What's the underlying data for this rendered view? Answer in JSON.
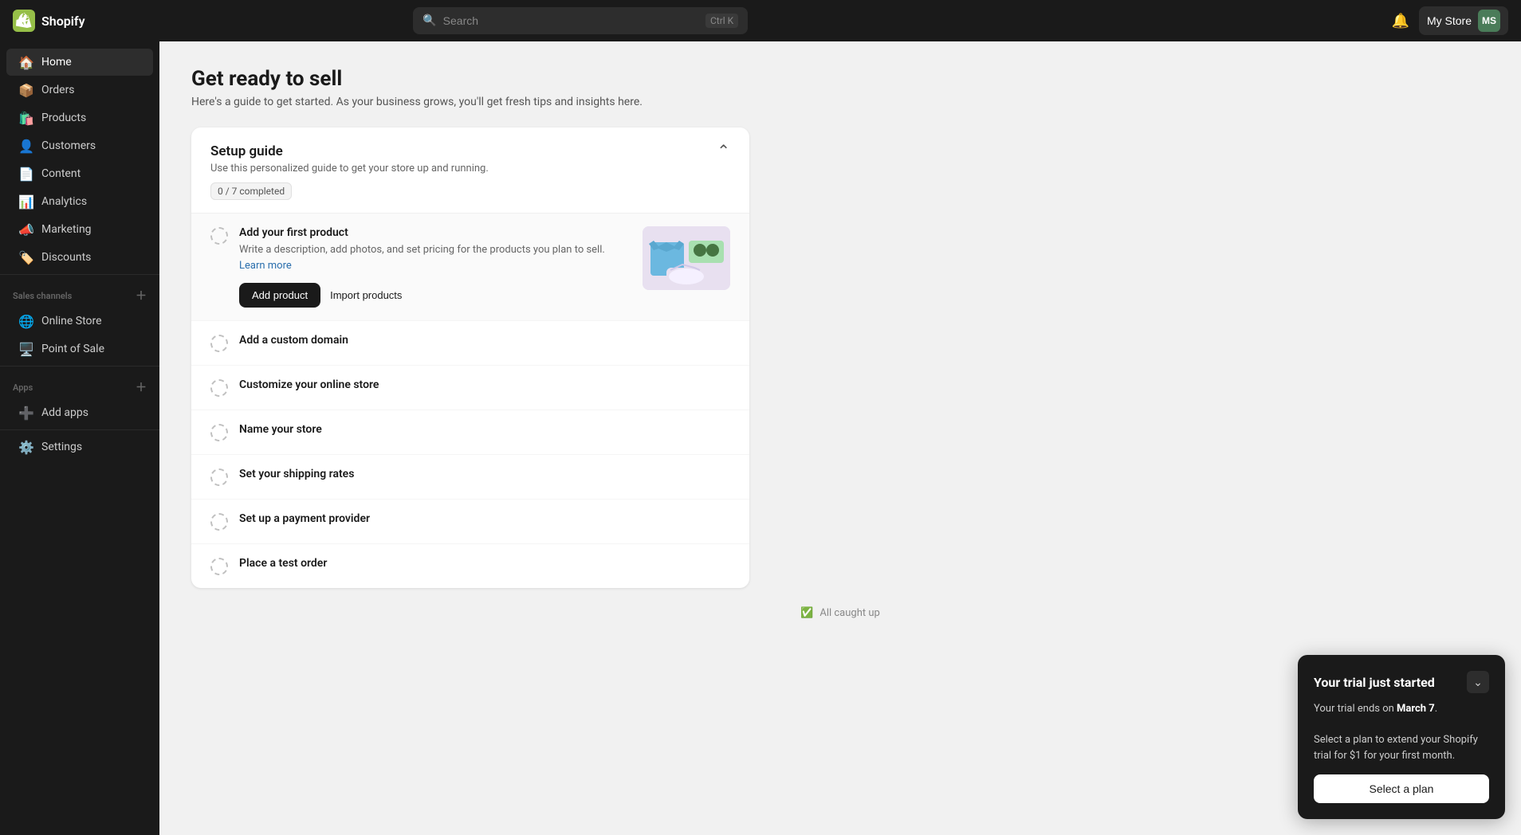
{
  "app": {
    "name": "Shopify"
  },
  "topnav": {
    "logo_text": "shopify",
    "search_placeholder": "Search",
    "search_shortcut": "Ctrl K",
    "store_name": "My Store",
    "avatar_initials": "MS",
    "avatar_color": "#4a7c59"
  },
  "sidebar": {
    "nav_items": [
      {
        "id": "home",
        "label": "Home",
        "icon": "🏠",
        "active": true
      },
      {
        "id": "orders",
        "label": "Orders",
        "icon": "📦",
        "active": false
      },
      {
        "id": "products",
        "label": "Products",
        "icon": "🛍️",
        "active": false
      },
      {
        "id": "customers",
        "label": "Customers",
        "icon": "👤",
        "active": false
      },
      {
        "id": "content",
        "label": "Content",
        "icon": "📄",
        "active": false
      },
      {
        "id": "analytics",
        "label": "Analytics",
        "icon": "📊",
        "active": false
      },
      {
        "id": "marketing",
        "label": "Marketing",
        "icon": "📣",
        "active": false
      },
      {
        "id": "discounts",
        "label": "Discounts",
        "icon": "🏷️",
        "active": false
      }
    ],
    "sales_channels_label": "Sales channels",
    "sales_channels": [
      {
        "id": "online-store",
        "label": "Online Store",
        "icon": "🌐"
      },
      {
        "id": "point-of-sale",
        "label": "Point of Sale",
        "icon": "🖥️"
      }
    ],
    "apps_label": "Apps",
    "apps_items": [
      {
        "id": "add-apps",
        "label": "Add apps",
        "icon": "➕"
      }
    ],
    "settings_label": "Settings",
    "settings_icon": "⚙️"
  },
  "main": {
    "title": "Get ready to sell",
    "subtitle": "Here's a guide to get started. As your business grows, you'll get fresh tips and insights here.",
    "setup_guide": {
      "title": "Setup guide",
      "description": "Use this personalized guide to get your store up and running.",
      "progress": "0 / 7 completed",
      "items": [
        {
          "id": "add-first-product",
          "title": "Add your first product",
          "description": "Write a description, add photos, and set pricing for the products you plan to sell.",
          "learn_more_text": "Learn more",
          "learn_more_url": "#",
          "expanded": true,
          "primary_btn": "Add product",
          "secondary_btn": "Import products",
          "has_image": true
        },
        {
          "id": "add-custom-domain",
          "title": "Add a custom domain",
          "expanded": false
        },
        {
          "id": "customize-online-store",
          "title": "Customize your online store",
          "expanded": false
        },
        {
          "id": "name-your-store",
          "title": "Name your store",
          "expanded": false
        },
        {
          "id": "set-shipping-rates",
          "title": "Set your shipping rates",
          "expanded": false
        },
        {
          "id": "set-up-payment",
          "title": "Set up a payment provider",
          "expanded": false
        },
        {
          "id": "place-test-order",
          "title": "Place a test order",
          "expanded": false
        }
      ]
    },
    "all_caught_up": "All caught up"
  },
  "trial_banner": {
    "title": "Your trial just started",
    "text_before_date": "Your trial ends on ",
    "date": "March 7",
    "text_after_date": ".",
    "description": "Select a plan to extend your Shopify trial for $1 for your first month.",
    "select_plan_btn": "Select a plan"
  }
}
